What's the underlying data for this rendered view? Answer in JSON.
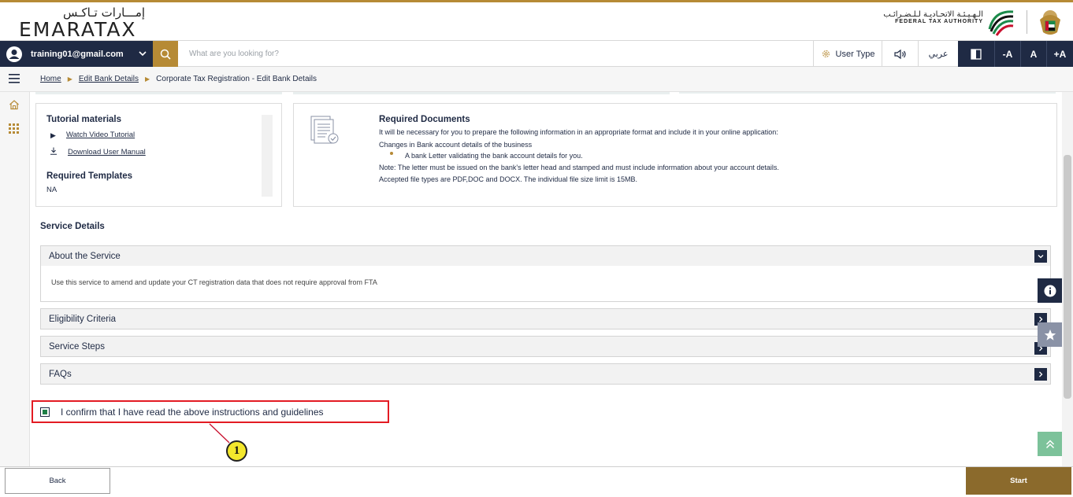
{
  "brand": {
    "logo_arabic": "إمـــارات تـاكـس",
    "logo_english": "EMARATAX",
    "authority_arabic": "الـهـيـئـة الاتحـاديـة لـلـضـرائـب",
    "authority_english": "FEDERAL TAX AUTHORITY"
  },
  "navbar": {
    "account_email": "training01@gmail.com",
    "search_placeholder": "What are you looking for?",
    "user_type_label": "User Type",
    "language_label": "عربي",
    "font_decrease": "-A",
    "font_normal": "A",
    "font_increase": "+A"
  },
  "breadcrumb": {
    "items": [
      "Home",
      "Edit Bank Details",
      "Corporate Tax Registration - Edit Bank Details"
    ]
  },
  "tutorial": {
    "title": "Tutorial materials",
    "video_link": "Watch Video Tutorial",
    "manual_link": "Download User Manual",
    "templates_title": "Required Templates",
    "templates_value": "NA"
  },
  "documents": {
    "title": "Required Documents",
    "intro": "It will be necessary for you to prepare the following information in an appropriate format and include it in your online application:",
    "subhead": "Changes in Bank account details of the business",
    "bullet": "A bank Letter validating the bank account details for you.",
    "note": "Note: The letter must be issued on the bank's letter head and stamped and must include information about your account details.",
    "file_types": "Accepted file types are PDF,DOC and DOCX. The individual file size limit is 15MB."
  },
  "service": {
    "heading": "Service Details",
    "sections": [
      {
        "title": "About the Service",
        "expanded": true,
        "body": "Use this service to amend and update your CT registration data that does not require approval from FTA"
      },
      {
        "title": "Eligibility Criteria",
        "expanded": false
      },
      {
        "title": "Service Steps",
        "expanded": false
      },
      {
        "title": "FAQs",
        "expanded": false
      }
    ]
  },
  "confirm": {
    "label": "I confirm that I have read the above instructions and guidelines",
    "checked": true
  },
  "callout": {
    "number": "1"
  },
  "footer": {
    "back_label": "Back",
    "start_label": "Start"
  },
  "colors": {
    "navy": "#1f2a44",
    "gold": "#b68a35",
    "highlight": "#e31b23",
    "callout": "#f3e72c"
  }
}
